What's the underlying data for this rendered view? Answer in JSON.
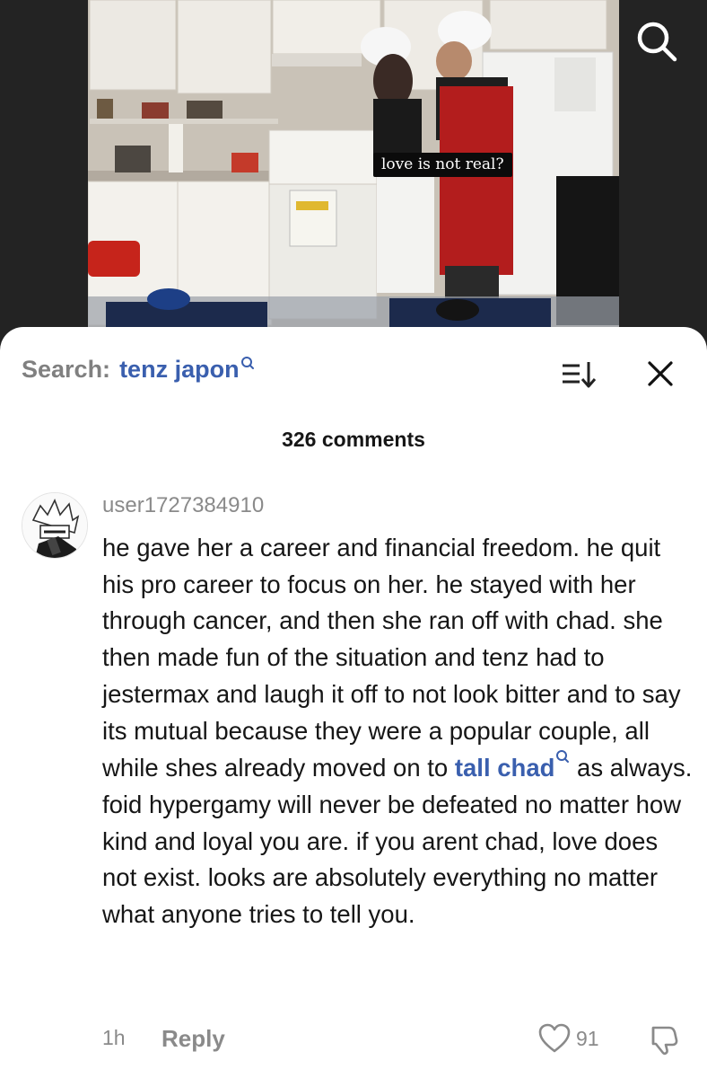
{
  "video": {
    "caption": "love is not real?"
  },
  "search": {
    "prefix": "Search:",
    "term": "tenz japon"
  },
  "comments_header": {
    "count_label": "326 comments"
  },
  "comment": {
    "username": "user1727384910",
    "text_before_link": "he gave her a career and financial freedom. he quit his pro career to focus on her. he stayed with her through cancer, and then she ran off with chad. she then made fun of the situation and tenz had to jestermax and laugh it off to not look bitter and to say its mutual because they were a popular couple, all while shes already moved on to ",
    "link_text": "tall chad",
    "text_after_link": " as always. foid hypergamy will never be defeated no matter how kind and loyal you are. if you arent chad, love does not exist. looks are absolutely everything no matter what anyone tries to tell you.",
    "time": "1h",
    "reply_label": "Reply",
    "like_count": "91"
  },
  "colors": {
    "link": "#3a5fae",
    "muted": "#8a8a8a",
    "text": "#161616"
  },
  "icons": [
    "search-icon",
    "sort-icon",
    "close-icon",
    "heart-icon",
    "dislike-icon",
    "search-mini-icon"
  ]
}
